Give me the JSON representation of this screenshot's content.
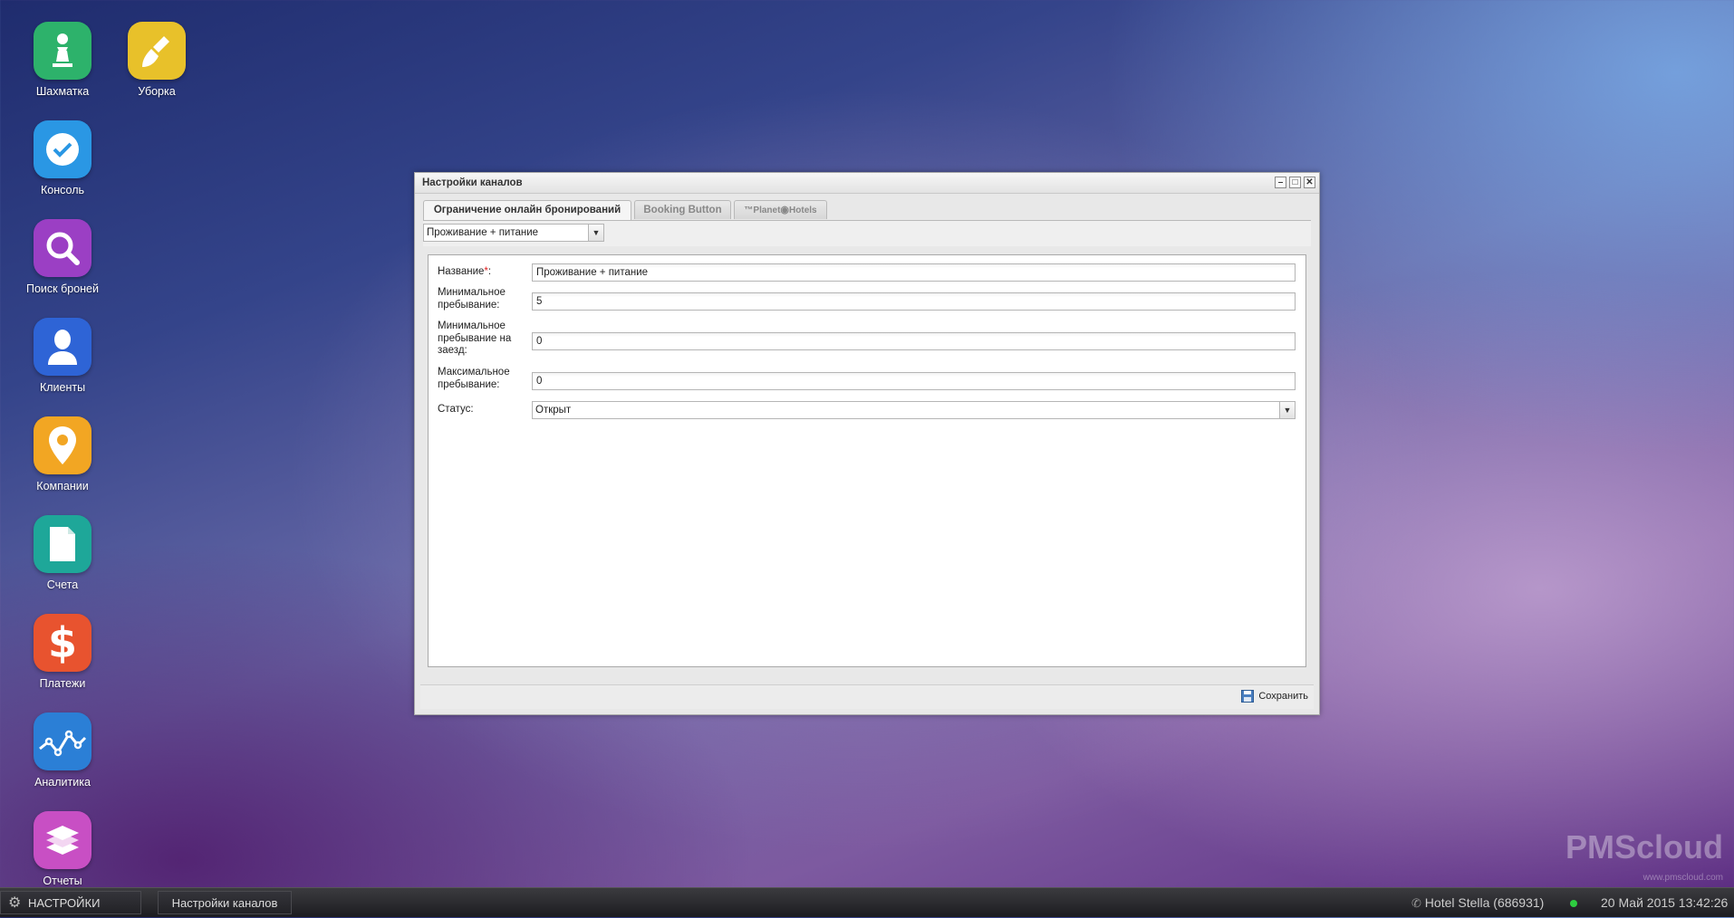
{
  "desktop": {
    "icons": [
      {
        "label": "Шахматка",
        "icon": "chess-pawn-icon",
        "color": "#2db26b"
      },
      {
        "label": "Уборка",
        "icon": "broom-icon",
        "color": "#e8c12a"
      },
      {
        "label": "Консоль",
        "icon": "checkmark-icon",
        "color": "#2a97e4"
      },
      {
        "label": "Поиск броней",
        "icon": "magnifier-icon",
        "color": "#9b3fc4"
      },
      {
        "label": "Клиенты",
        "icon": "person-icon",
        "color": "#2e64d6"
      },
      {
        "label": "Компании",
        "icon": "map-pin-icon",
        "color": "#f2a623"
      },
      {
        "label": "Счета",
        "icon": "document-icon",
        "color": "#1ea799"
      },
      {
        "label": "Платежи",
        "icon": "dollar-icon",
        "color": "#e8532f"
      },
      {
        "label": "Аналитика",
        "icon": "line-chart-icon",
        "color": "#2b7fd6"
      },
      {
        "label": "Отчеты",
        "icon": "books-icon",
        "color": "#c84fc4"
      }
    ]
  },
  "window": {
    "title": "Настройки каналов",
    "tabs": [
      {
        "label": "Ограничение онлайн бронирований",
        "active": true
      },
      {
        "label": "Booking Button",
        "active": false
      },
      {
        "label": "Planet Hotels",
        "active": false,
        "logo_prefix": "™Planet",
        "logo_suffix": "Hotels"
      }
    ],
    "selector_value": "Проживание + питание",
    "form": {
      "name_label": "Название",
      "required_mark": "*",
      "colon": ":",
      "name_value": "Проживание + питание",
      "min_stay_label": "Минимальное пребывание:",
      "min_stay_value": "5",
      "min_stay_arrival_label": "Минимальное пребывание на заезд:",
      "min_stay_arrival_value": "0",
      "max_stay_label": "Максимальное пребывание:",
      "max_stay_value": "0",
      "status_label": "Статус:",
      "status_value": "Открыт"
    },
    "save_label": "Сохранить"
  },
  "taskbar": {
    "start_label": "НАСТРОЙКИ",
    "open_window_label": "Настройки каналов",
    "hotel": "Hotel Stella (686931)",
    "datetime": "20 Май 2015 13:42:26",
    "status_color": "#2ecc40"
  },
  "watermark": {
    "brand_pms": "PMS",
    "brand_cloud": "cloud",
    "url": "www.pmscloud.com"
  }
}
